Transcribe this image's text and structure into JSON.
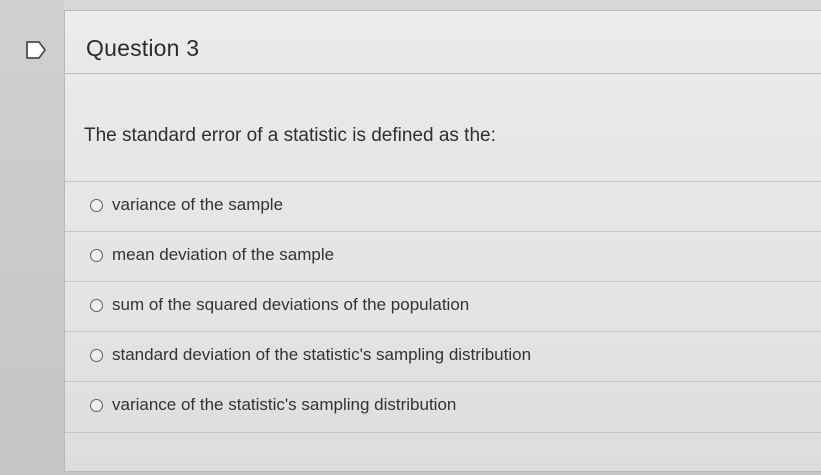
{
  "question": {
    "title": "Question 3",
    "text": "The standard error of a statistic is defined as the:",
    "options": [
      {
        "label": "variance of the sample"
      },
      {
        "label": "mean deviation of the sample"
      },
      {
        "label": "sum of the squared deviations of the population"
      },
      {
        "label": "standard deviation of the statistic's sampling distribution"
      },
      {
        "label": "variance of the statistic's sampling distribution"
      }
    ]
  },
  "icons": {
    "flag": "flag-icon",
    "radio": "radio-unselected-icon"
  },
  "colors": {
    "background": "#cdd0cf",
    "card": "#e6e7e6",
    "text": "#2f2f2f",
    "divider": "#c3c6c5"
  }
}
